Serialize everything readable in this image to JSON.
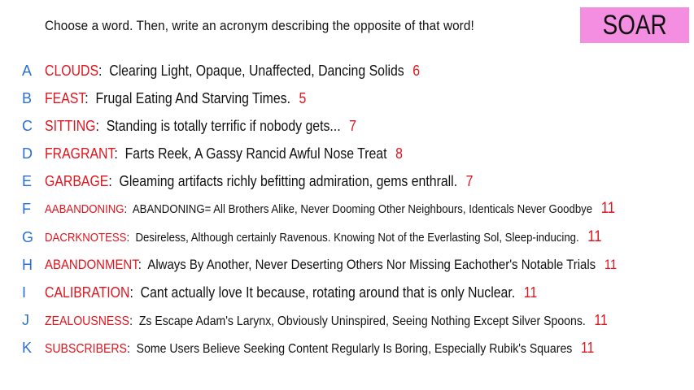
{
  "prompt": "Choose a word. Then, write an acronym describing the opposite of that word!",
  "badge": "SOAR",
  "rows": [
    {
      "letter": "A",
      "word": "CLOUDS",
      "acronym": "Clearing Light,  Opaque, Unaffected,  Dancing Solids",
      "count": "6"
    },
    {
      "letter": "B",
      "word": "FEAST",
      "acronym": "Frugal Eating And Starving Times.",
      "count": "5"
    },
    {
      "letter": "C",
      "word": "SITTING",
      "acronym": "Standing is totally terrific if nobody gets...",
      "count": "7"
    },
    {
      "letter": "D",
      "word": "FRAGRANT",
      "acronym": "Farts Reek, A Gassy Rancid Awful Nose Treat",
      "count": "8"
    },
    {
      "letter": "E",
      "word": "GARBAGE",
      "acronym": "Gleaming artifacts richly befitting admiration, gems enthrall.",
      "count": "7"
    },
    {
      "letter": "F",
      "word": "AABANDONING",
      "acronym": "ABANDONING= All Brothers Alike, Never Dooming Other Neighbours, Identicals Never Goodbye",
      "count": "11"
    },
    {
      "letter": "G",
      "word": "DACRKNOTESS",
      "acronym": "Desireless, Although certainly Ravenous. Knowing Not of the Everlasting Sol, Sleep-inducing.",
      "count": "11"
    },
    {
      "letter": "H",
      "word": "ABANDONMENT",
      "acronym": "Always By Another, Never Deserting Others Nor Missing Eachother's Notable Trials",
      "count": "11"
    },
    {
      "letter": "I",
      "word": "CALIBRATION",
      "acronym": "Cant actually love It because, rotating around that is only Nuclear.",
      "count": "11"
    },
    {
      "letter": "J",
      "word": "ZEALOUSNESS",
      "acronym": "Zs Escape Adam's Larynx, Obviously Uninspired, Seeing Nothing Except Silver Spoons.",
      "count": "11"
    },
    {
      "letter": "K",
      "word": "SUBSCRIBERS",
      "acronym": "Some Users Believe Seeking Content Regularly Is Boring, Especially Rubik's Squares",
      "count": "11"
    }
  ]
}
